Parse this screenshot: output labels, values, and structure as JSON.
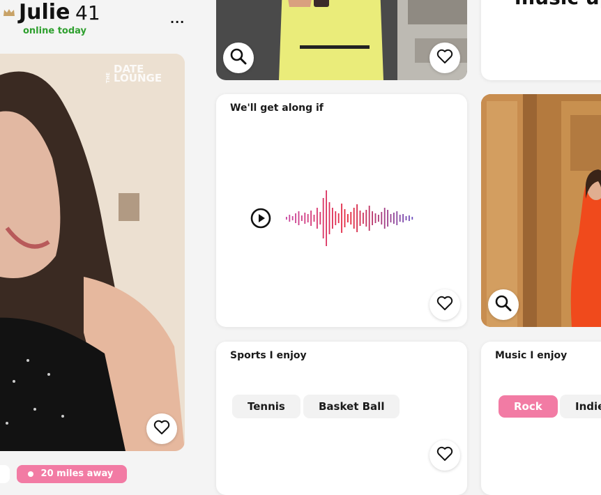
{
  "profile": {
    "name": "Julie",
    "age": "41",
    "status": "online today",
    "more_label": "...",
    "distance_label": "20 miles away",
    "watermark_line1": "THE",
    "watermark_line2": "DATE",
    "watermark_line3": "LOUNGE"
  },
  "top_right_card": {
    "title_partial": "music up"
  },
  "voice_card": {
    "title": "We'll get along if"
  },
  "sports_card": {
    "title": "Sports I enjoy",
    "chips": [
      "Tennis",
      "Basket Ball"
    ]
  },
  "music_card": {
    "title": "Music I enjoy",
    "chips": [
      "Rock",
      "Indie"
    ]
  },
  "colors": {
    "accent_pink": "#f27ba4",
    "online_green": "#2e9f2e",
    "crown_gold": "#c8a267"
  },
  "icons": [
    "crown-icon",
    "more-icon",
    "zoom-icon",
    "heart-icon",
    "play-icon",
    "location-pin-icon"
  ]
}
